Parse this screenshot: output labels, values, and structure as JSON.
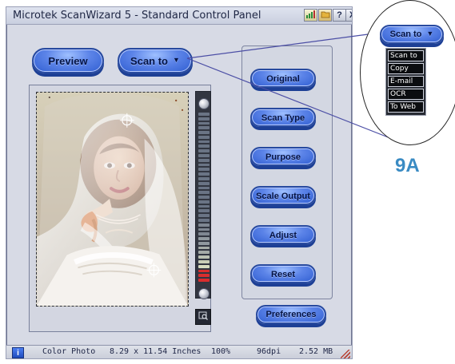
{
  "window": {
    "title": "Microtek ScanWizard 5 - Standard Control Panel"
  },
  "toolbar": {
    "preview_label": "Preview",
    "scan_to_label": "Scan to"
  },
  "side_panel": {
    "items": [
      {
        "label": "Original"
      },
      {
        "label": "Scan Type"
      },
      {
        "label": "Purpose"
      },
      {
        "label": "Scale Output"
      },
      {
        "label": "Adjust"
      },
      {
        "label": "Reset"
      }
    ],
    "preferences_label": "Preferences"
  },
  "status": {
    "info_label": "i",
    "color_mode": "Color Photo",
    "size": "8.29 x 11.54 Inches",
    "zoom": "100%",
    "dpi": "96dpi",
    "file_size": "2.52 MB"
  },
  "callout": {
    "button_label": "Scan to",
    "menu_items": [
      "Scan to",
      "Copy",
      "E-mail",
      "OCR",
      "To Web"
    ],
    "figure_label": "9A"
  },
  "title_buttons": {
    "help_label": "?",
    "close_label": "X"
  },
  "icons": {
    "chart": "chart-icon",
    "folder": "folder-icon",
    "help": "help-icon",
    "close": "close-icon",
    "info": "info-icon",
    "zoom": "magnifier-icon",
    "dropdown": "chevron-down-icon",
    "resize": "resize-grip-icon"
  },
  "slider": {
    "segments": [
      "#6a7485",
      "#6a7485",
      "#6a7485",
      "#6a7485",
      "#6a7485",
      "#6a7485",
      "#6a7485",
      "#6a7485",
      "#6a7485",
      "#6a7485",
      "#6a7485",
      "#6a7485",
      "#6a7485",
      "#6a7485",
      "#6a7485",
      "#6a7485",
      "#6a7485",
      "#6a7485",
      "#6a7485",
      "#6a7485",
      "#6a7485",
      "#6a7485",
      "#6a7485",
      "#6a7485",
      "#7f8792",
      "#7f8792",
      "#7f8792",
      "#90989f",
      "#90989f",
      "#a5aba7",
      "#a5aba7",
      "#bbc1b2",
      "#c9ceb7",
      "#d7dcbf",
      "#d92d2e",
      "#d92d2e",
      "#d92d2e"
    ]
  }
}
